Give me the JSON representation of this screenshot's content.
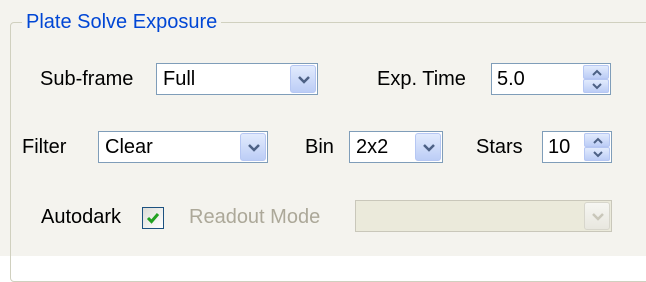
{
  "group": {
    "title": "Plate Solve Exposure"
  },
  "subframe": {
    "label": "Sub-frame",
    "value": "Full"
  },
  "exptime": {
    "label": "Exp. Time",
    "value": "5.0"
  },
  "filter": {
    "label": "Filter",
    "value": "Clear"
  },
  "bin": {
    "label": "Bin",
    "value": "2x2"
  },
  "stars": {
    "label": "Stars",
    "value": "10"
  },
  "autodark": {
    "label": "Autodark",
    "checked": true
  },
  "readout": {
    "label": "Readout Mode",
    "value": "",
    "enabled": false
  },
  "colors": {
    "group_title": "#0046d5",
    "panel_bg": "#f4f3ee",
    "input_border": "#7f9db9",
    "check_mark": "#21a121",
    "disabled_text": "#aca899"
  },
  "icons": {
    "dropdown": "chevron-down-icon",
    "spin_up": "spin-up-icon",
    "spin_down": "spin-down-icon",
    "check": "checkmark-icon"
  }
}
